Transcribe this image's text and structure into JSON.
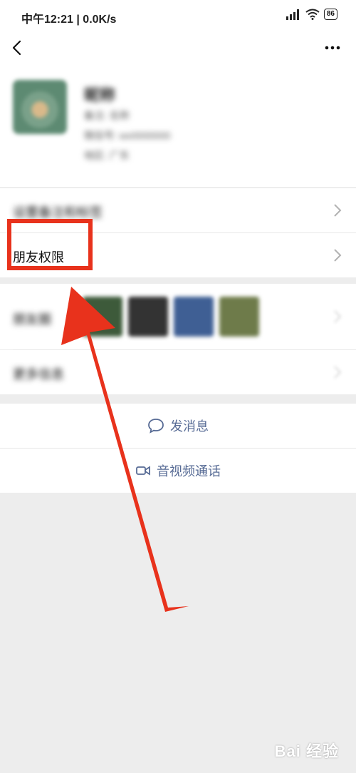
{
  "status_bar": {
    "time": "中午12:21 | 0.0K/s",
    "battery": "86"
  },
  "nav": {
    "back_label": "",
    "more_label": ""
  },
  "profile": {
    "nickname": "昵称",
    "line1": "备注: 名称",
    "line2": "微信号: wx0000000",
    "line3": "地区: 广东"
  },
  "rows": {
    "blurred_row": "设置备注和标签",
    "permissions": "朋友权限",
    "moments": "朋友圈",
    "more_info": "更多信息"
  },
  "actions": {
    "message": "发消息",
    "call": "音视频通话"
  },
  "watermark": "Bai 经验",
  "colors": {
    "accent": "#576b95",
    "annotation": "#e8321c"
  }
}
